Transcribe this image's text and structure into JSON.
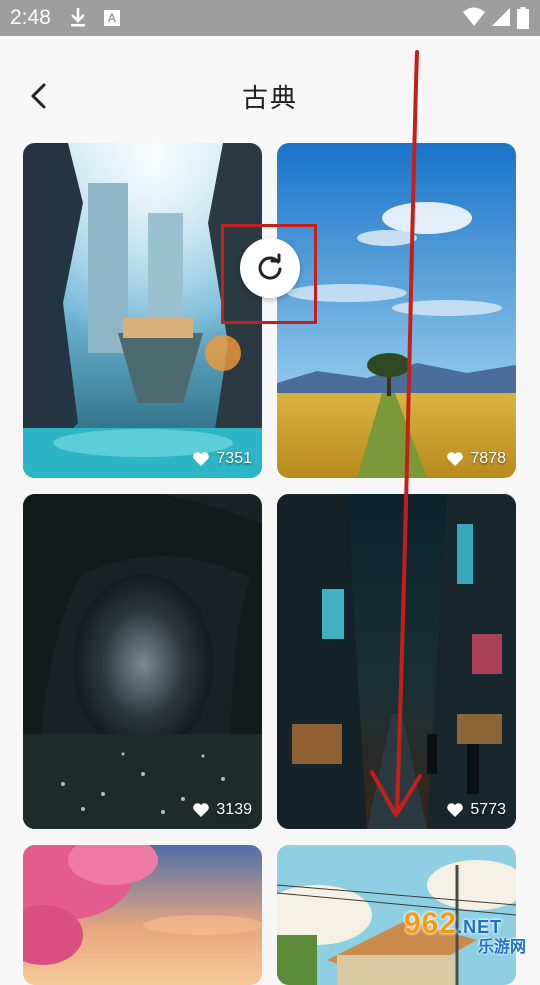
{
  "status_bar": {
    "time": "2:48",
    "icons": [
      "download-icon",
      "a-box-icon",
      "wifi-icon",
      "signal-icon",
      "battery-icon"
    ]
  },
  "header": {
    "title": "古典",
    "back_icon": "chevron-left-icon"
  },
  "wallpapers": [
    {
      "likes": "7351",
      "theme": "fantasy floating city with waterfalls"
    },
    {
      "likes": "7878",
      "theme": "golden wheat field under blue sky with tree"
    },
    {
      "likes": "3139",
      "theme": "dark forest tree tunnel with glowing flowers"
    },
    {
      "likes": "5773",
      "theme": "neon cyberpunk alley at night"
    },
    {
      "likes": "",
      "theme": "pink cherry blossoms at sunset"
    },
    {
      "likes": "",
      "theme": "countryside house with power lines"
    }
  ],
  "overlay": {
    "refresh_icon": "refresh-icon",
    "highlight_color": "#c4201b",
    "arrow_color": "#c4201b"
  },
  "watermark": {
    "main": "962",
    "domain": ".NET",
    "sub": "乐游网"
  },
  "colors": {
    "status_bar": "#9e9e9e",
    "background": "#f7f7f7",
    "title": "#222222"
  }
}
